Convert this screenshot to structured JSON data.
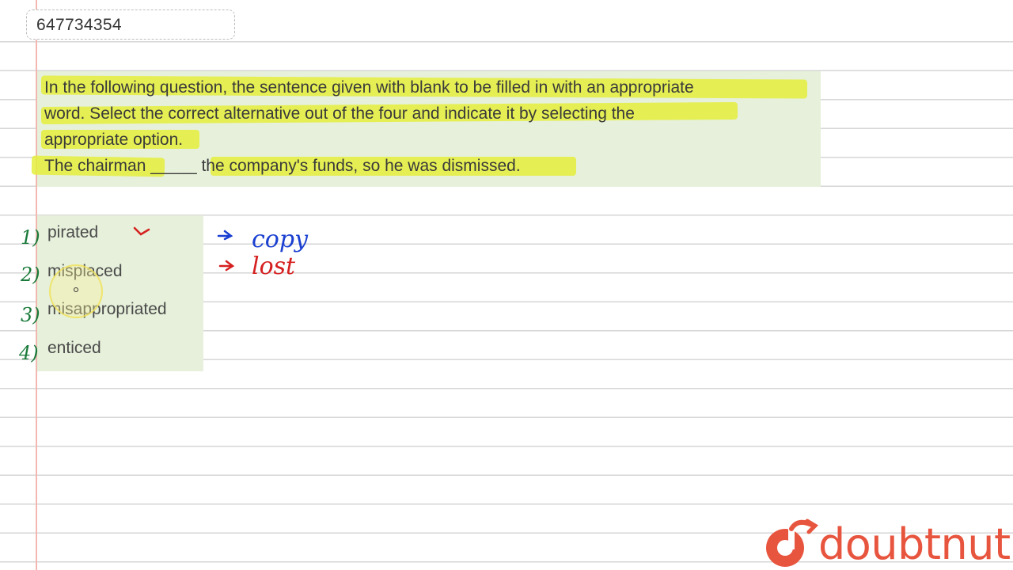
{
  "question_id": "647734354",
  "question": {
    "line1": "In the following question, the sentence given with blank to be filled in with an appropriate",
    "line2": "word. Select the correct alternative out of the four and indicate it by selecting the",
    "line3": "appropriate option.",
    "line4": "The chairman _____ the company's funds, so he was dismissed."
  },
  "options": [
    {
      "number": "1)",
      "label": "pirated"
    },
    {
      "number": "2)",
      "label": "misplaced"
    },
    {
      "number": "3)",
      "label": "misappropriated"
    },
    {
      "number": "4)",
      "label": "enticed"
    }
  ],
  "annotations": {
    "note1": "copy",
    "note2": "lost"
  },
  "brand": {
    "name": "doubtnut",
    "color": "#e8553f"
  },
  "colors": {
    "box_bg": "#e6f0da",
    "highlight": "#e4ef3c",
    "handwriting_green": "#1a7a3a",
    "handwriting_blue": "#1a3fd1",
    "handwriting_red": "#d62020"
  }
}
